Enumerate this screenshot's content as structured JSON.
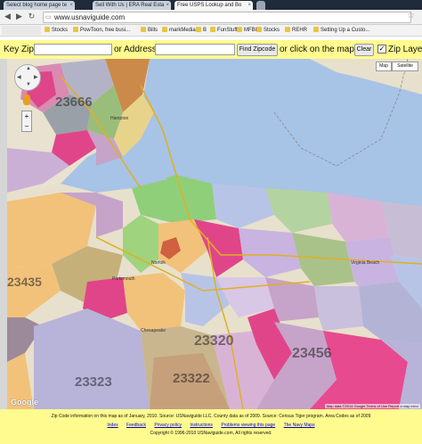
{
  "tabs": [
    {
      "label": "Select blog home page te",
      "active": false
    },
    {
      "label": "Sell With Us | ERA Real Esta",
      "active": false
    },
    {
      "label": "Free USPS Lookup and Bo",
      "active": true
    }
  ],
  "url": "www.usnaviguide.com",
  "bookmarks": [
    "Stocks",
    "PowToon, free busi...",
    "Bills",
    "markMedia",
    "B",
    "FunStuff",
    "MFBIZ",
    "Stocks",
    "REHR",
    "Setting Up a Custo..."
  ],
  "zipbar": {
    "key_zip_label": "Key Zip",
    "or_address_label": "or Address",
    "find_button": "Find Zipcode",
    "click_label": "or click on the map.",
    "clear_button": "Clear",
    "zip_layer_label": "Zip Layer",
    "zip_layer_checked": "✓"
  },
  "map": {
    "type_buttons": [
      "Map",
      "Satellite"
    ],
    "zip_labels": [
      "23666",
      "23435",
      "23320",
      "23456",
      "23323",
      "23322"
    ],
    "place_labels": [
      "Hampton",
      "Norfolk",
      "Portsmouth",
      "Chesapeake",
      "Virginia Beach"
    ],
    "google_logo": "Google",
    "footer_text": "Map data ©2014 Google   Terms of Use   Report a map error"
  },
  "footer": {
    "line1": "Zip Code information on this map as of January, 2010. Source: USNaviguide LLC. County data as of 2009. Source: Census Tiger program. Area Codes as of 2009",
    "links": [
      "Index",
      "Feedback",
      "Privacy policy",
      "Instructions",
      "Problems viewing this page",
      "The Navy Maps"
    ],
    "line3": "Copyright © 1996-2010 USNaviguide.com, All rights reserved."
  }
}
